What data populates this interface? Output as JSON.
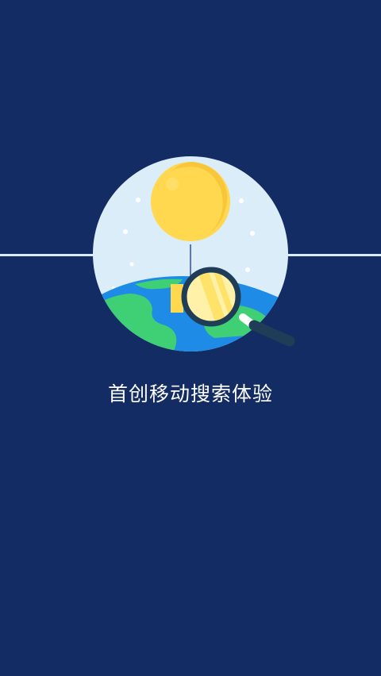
{
  "splash": {
    "tagline": "首创移动搜索体验",
    "colors": {
      "background": "#132c63",
      "circle": "#dcedfa",
      "balloon": "#ffd84f",
      "land": "#3fcf74",
      "water": "#1e8be6",
      "lens": "#fff1a8",
      "magnifier_frame": "#203d57"
    },
    "icons": {
      "illustration": "balloon-globe-magnifier-icon"
    }
  }
}
